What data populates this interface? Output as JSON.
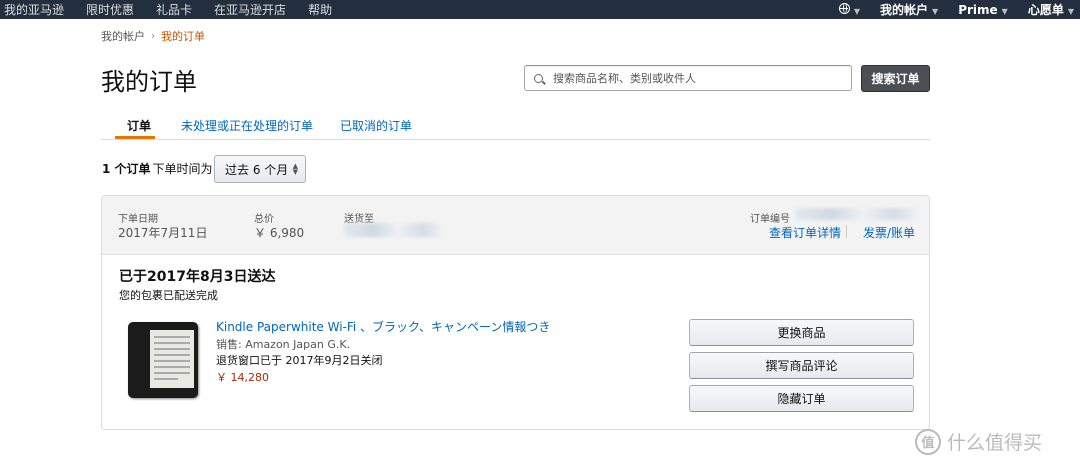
{
  "topnav": {
    "left_items": [
      "我的亚马逊",
      "限时优惠",
      "礼品卡",
      "在亚马逊开店",
      "帮助"
    ],
    "account_label": "我的帐户",
    "prime_label": "Prime",
    "wishlist_label": "心愿单"
  },
  "breadcrumb": {
    "parent": "我的帐户",
    "separator": "›",
    "current": "我的订单"
  },
  "page_title": "我的订单",
  "search": {
    "placeholder": "搜索商品名称、类别或收件人",
    "value": "",
    "button_label": "搜索订单"
  },
  "tabs": [
    {
      "label": "订单",
      "active": true
    },
    {
      "label": "未处理或正在处理的订单",
      "active": false
    },
    {
      "label": "已取消的订单",
      "active": false
    }
  ],
  "summary": {
    "count": "1 个订单",
    "text": "下单时间为",
    "period": "过去 6 个月"
  },
  "order": {
    "date_label": "下单日期",
    "date_value": "2017年7月11日",
    "total_label": "总价",
    "total_value": "￥ 6,980",
    "ship_label": "送货至",
    "number_label": "订单编号",
    "details_link": "查看订单详情",
    "invoice_link": "发票/账单",
    "delivery_status": "已于2017年8月3日送达",
    "delivery_sub": "您的包裹已配送完成",
    "product": {
      "title": "Kindle Paperwhite Wi-Fi 、ブラック、キャンペーン情報つき",
      "seller": "销售: Amazon Japan G.K.",
      "return_window": "退货窗口已于 2017年9月2日关闭",
      "price": "￥ 14,280"
    },
    "actions": [
      "更换商品",
      "撰写商品评论",
      "隐藏订单"
    ]
  },
  "watermark": {
    "symbol": "值",
    "text": "什么值得买"
  },
  "colors": {
    "topbar": "#232f3e",
    "link": "#0066c0",
    "accent": "#e77600",
    "price": "#b12704",
    "breadcrumb_current": "#c45500"
  }
}
